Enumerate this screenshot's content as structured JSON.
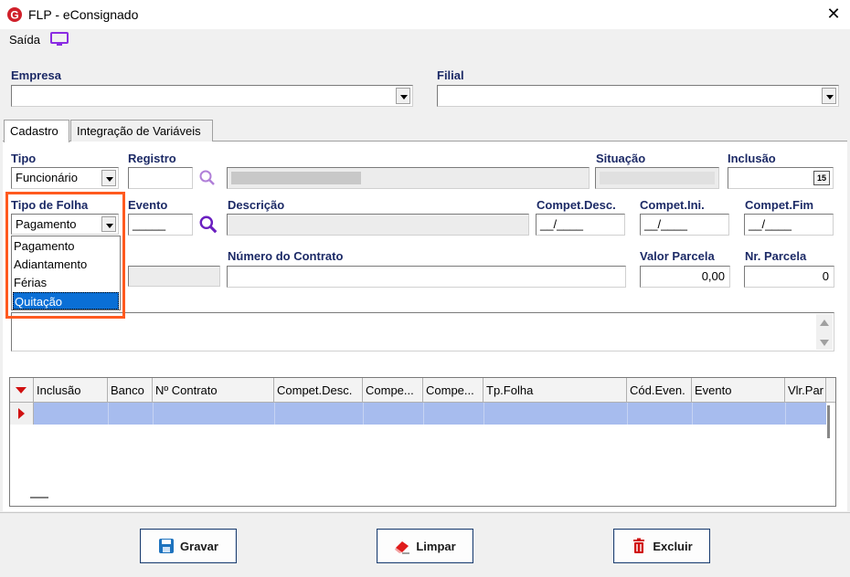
{
  "window": {
    "title": "FLP - eConsignado",
    "close_label": "✕"
  },
  "menu": {
    "saida_label": "Saída"
  },
  "empresa": {
    "label": "Empresa",
    "value": ""
  },
  "filial": {
    "label": "Filial",
    "value": ""
  },
  "tabs": [
    {
      "label": "Cadastro",
      "active": true
    },
    {
      "label": "Integração de Variáveis",
      "active": false
    }
  ],
  "form": {
    "tipo_label": "Tipo",
    "tipo_value": "Funcionário",
    "registro_label": "Registro",
    "registro_value": "",
    "situacao_label": "Situação",
    "inclusao_label": "Inclusão",
    "calendar_glyph": "15",
    "tipo_folha_label": "Tipo de Folha",
    "tipo_folha_value": "Pagamento",
    "evento_label": "Evento",
    "evento_value": "_____",
    "descricao_label": "Descrição",
    "compet_desc_label": "Compet.Desc.",
    "compet_desc_value": "__/____",
    "compet_ini_label": "Compet.Ini.",
    "compet_ini_value": "__/____",
    "compet_fim_label": "Compet.Fim",
    "compet_fim_value": "__/____",
    "numero_contrato_label": "Número do Contrato",
    "numero_contrato_value": "",
    "valor_parcela_label": "Valor Parcela",
    "valor_parcela_value": "0,00",
    "nr_parcela_label": "Nr. Parcela",
    "nr_parcela_value": "0"
  },
  "tipo_folha_options": [
    "Pagamento",
    "Adiantamento",
    "Férias",
    "Quitação"
  ],
  "tipo_folha_selected": "Quitação",
  "grid": {
    "columns": [
      "Inclusão",
      "Banco",
      "Nº Contrato",
      "Compet.Desc.",
      "Compe...",
      "Compe...",
      "Tp.Folha",
      "Cód.Even.",
      "Evento",
      "Vlr.Par"
    ],
    "rows": []
  },
  "buttons": {
    "gravar": "Gravar",
    "limpar": "Limpar",
    "excluir": "Excluir"
  },
  "colors": {
    "label_blue": "#1c2a66",
    "selection": "#0a6fd6",
    "highlight": "#ff5a1f",
    "row": "#a7bcee",
    "icon_purple": "#8a2be2"
  }
}
